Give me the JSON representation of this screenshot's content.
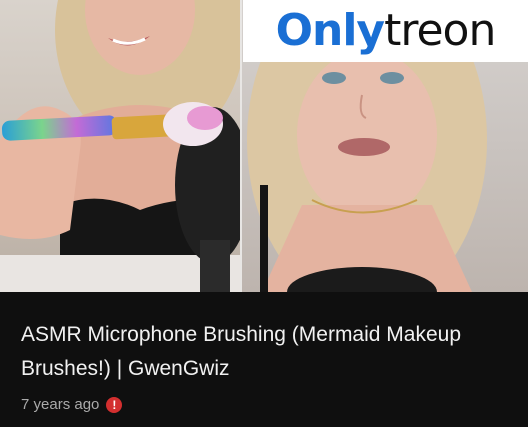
{
  "watermark": {
    "part1": "Only",
    "part2": "treon"
  },
  "video": {
    "title": "ASMR Microphone Brushing (Mermaid Makeup Brushes!) | GwenGwiz",
    "age": "7 years ago",
    "alert_icon": "!"
  },
  "colors": {
    "watermark_blue": "#1a6fd4",
    "background": "#0f0f0f",
    "alert": "#d32f2f"
  },
  "icons": [
    "microphone-icon",
    "makeup-brush-icon",
    "alert-icon"
  ]
}
